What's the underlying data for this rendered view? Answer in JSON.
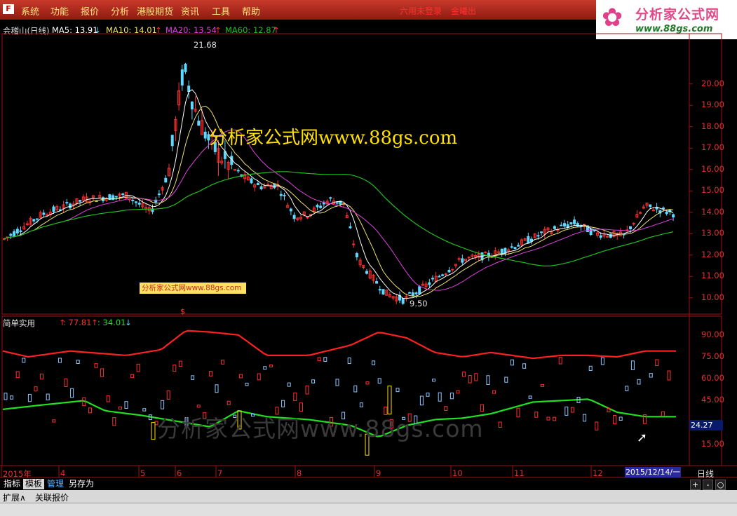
{
  "menu": {
    "items": [
      "系统",
      "功能",
      "报价",
      "分析",
      "港股期货",
      "资讯",
      "工具",
      "帮助"
    ],
    "login_status": "六用未登录",
    "login_action": "金曦出"
  },
  "logo": {
    "title": "分析家公式网",
    "url": "www.88gs.com"
  },
  "chart": {
    "stock": "会稽山(日线)",
    "ma5": "MA5: 13.91",
    "ma10": "MA10: 14.01",
    "ma20": "MA20: 13.54",
    "ma60": "MA60: 12.87",
    "high_label": "21.68",
    "low_label": "9.50",
    "price_axis": [
      "20.00",
      "19.00",
      "18.00",
      "17.00",
      "16.00",
      "15.00",
      "14.00",
      "13.00",
      "12.00",
      "11.00",
      "10.00"
    ],
    "marker": "$"
  },
  "indicator": {
    "name": "简单实用",
    "v1": ": 77.81",
    "v2": ": 34.01",
    "axis": [
      "90.00",
      "75.00",
      "60.00",
      "45.00",
      "15.00"
    ],
    "current": "24.27"
  },
  "dates": [
    "2015年",
    "4",
    "5",
    "6",
    "7",
    "8",
    "9",
    "10",
    "11",
    "12"
  ],
  "cursor_date": "2015/12/14/一",
  "period": "日线",
  "tabs": [
    "指标",
    "模板",
    "管理",
    "另存为"
  ],
  "bottom": [
    "扩展∧",
    "关联报价"
  ],
  "watermarks": {
    "big": "分析家公式网www.88gs.com",
    "small": "分析家公式网www.88gs.com",
    "bottom": "分析家公式网www.88gs.com"
  },
  "colors": {
    "up": "#ff3030",
    "down": "#5ed8ff",
    "ma5": "#ffffff",
    "ma10": "#f0e070",
    "ma20": "#e040e0",
    "ma60": "#20c020",
    "osc_top": "#ff2020",
    "osc_bottom": "#20e020"
  }
}
